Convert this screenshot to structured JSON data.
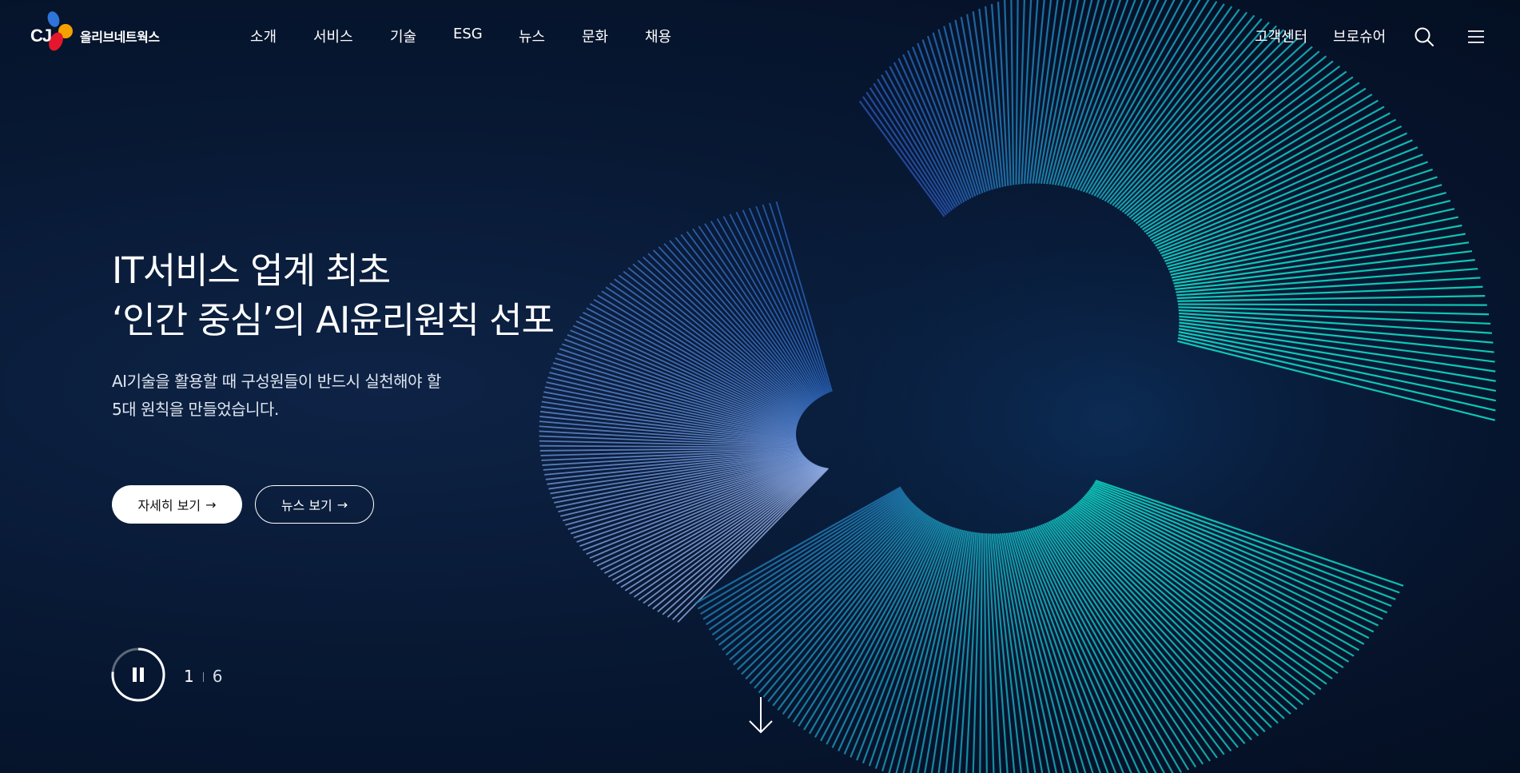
{
  "brand": {
    "logo_mark": "CJ",
    "name": "올리브네트웍스",
    "colors": {
      "blue": "#2f74d8",
      "orange": "#f5a100",
      "red": "#e4172c"
    }
  },
  "nav": {
    "items": [
      "소개",
      "서비스",
      "기술",
      "ESG",
      "뉴스",
      "문화",
      "채용"
    ]
  },
  "utility": {
    "customer_center": "고객센터",
    "brochure": "브로슈어",
    "search_icon": "search-icon",
    "menu_icon": "hamburger-menu-icon"
  },
  "hero": {
    "title_line1": "IT서비스 업계 최초",
    "title_line2": "‘인간 중심’의 AI윤리원칙 선포",
    "desc_line1": "AI기술을 활용할 때 구성원들이 반드시 실천해야 할",
    "desc_line2": "5대 원칙을 만들었습니다.",
    "primary_button": "자세히 보기",
    "secondary_button": "뉴스 보기",
    "arrow_glyph": "→"
  },
  "slider": {
    "current": "1",
    "total": "6",
    "state": "playing",
    "control_icon": "pause-icon"
  },
  "scroll": {
    "icon": "arrow-down-icon"
  },
  "theme": {
    "background": "#06142a",
    "accent_teal": "#12e0c8",
    "accent_blue": "#3a6fd0"
  }
}
